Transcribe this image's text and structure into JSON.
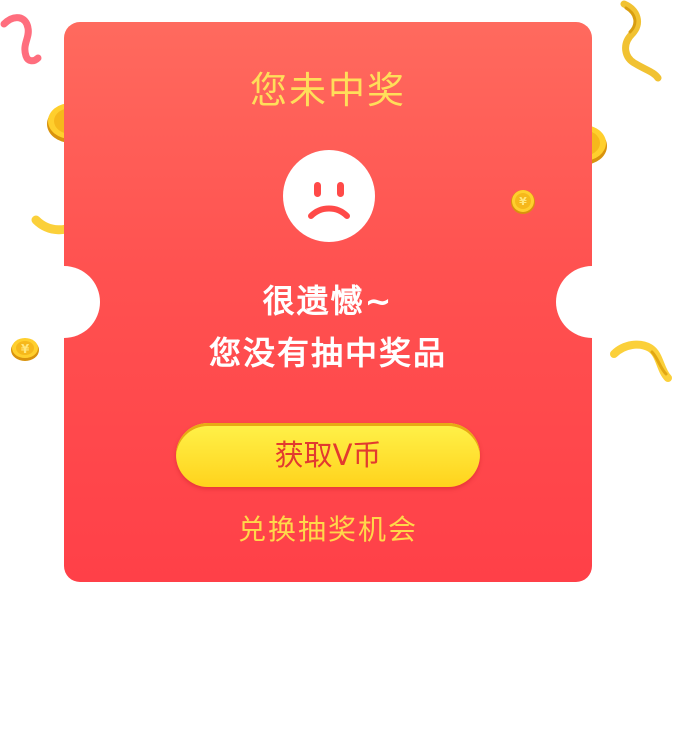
{
  "dialog": {
    "title": "您未中奖",
    "face_icon": "sad-face-icon",
    "message_line1": "很遗憾~",
    "message_line2": "您没有抽中奖品",
    "primary_button_label": "获取V币",
    "secondary_link_label": "兑换抽奖机会"
  },
  "decorations": {
    "coin_icon": "yen-coin-icon",
    "coin_symbol": "¥",
    "ribbon_icon": "ribbon-icon"
  },
  "colors": {
    "card_top": "#ff6a5e",
    "card_bottom": "#ff4048",
    "title": "#ffde5a",
    "button": "#ffe033",
    "button_text": "#e23a2f",
    "link_text": "#ffd84a"
  }
}
